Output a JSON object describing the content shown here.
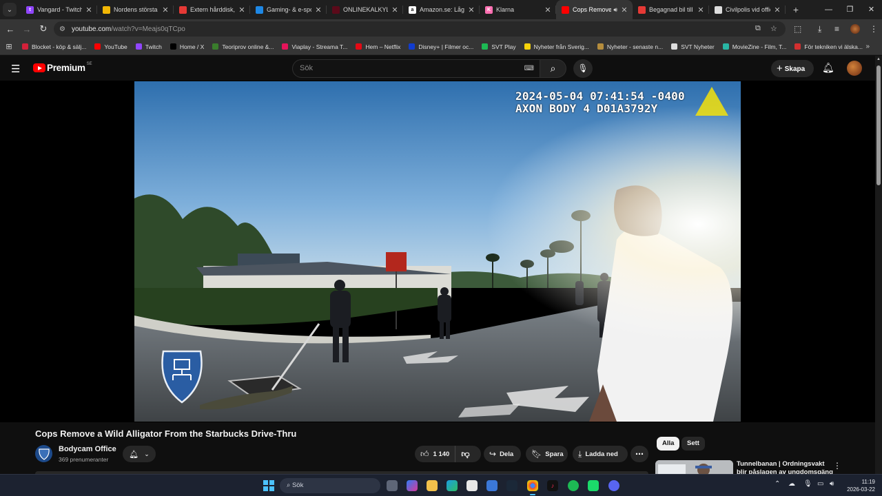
{
  "browser": {
    "tabs": [
      {
        "title": "Vangard - Twitch",
        "fav_color": "#9146ff",
        "fav_glyph": "t",
        "active": false
      },
      {
        "title": "Nordens största e",
        "fav_color": "#f2b705",
        "fav_glyph": "",
        "active": false
      },
      {
        "title": "Extern hårddisk, S",
        "fav_color": "#e53935",
        "fav_glyph": "",
        "active": false
      },
      {
        "title": "Gaming- & e-sport",
        "fav_color": "#1e88e5",
        "fav_glyph": "",
        "active": false
      },
      {
        "title": "ONLINEKALKYLAT",
        "fav_color": "#5b0a1a",
        "fav_glyph": "",
        "active": false
      },
      {
        "title": "Amazon.se: Låga p",
        "fav_color": "#ffffff",
        "fav_glyph": "a",
        "active": false
      },
      {
        "title": "Klarna",
        "fav_color": "#ff6fb1",
        "fav_glyph": "K",
        "active": false
      },
      {
        "title": "Cops Remove",
        "fav_color": "#ff0000",
        "fav_glyph": "",
        "active": true,
        "playing": true
      },
      {
        "title": "Begagnad bil till s",
        "fav_color": "#e53935",
        "fav_glyph": "",
        "active": false
      },
      {
        "title": "Civilpolis vid offic",
        "fav_color": "#dddddd",
        "fav_glyph": "",
        "active": false
      }
    ],
    "url_host": "youtube.com",
    "url_path": "/watch?v=Meajs0qTCpo",
    "bookmarks": [
      {
        "label": "Blocket - köp & sälj...",
        "color": "#d3213a"
      },
      {
        "label": "YouTube",
        "color": "#ff0000"
      },
      {
        "label": "Twitch",
        "color": "#9146ff"
      },
      {
        "label": "Home / X",
        "color": "#000000"
      },
      {
        "label": "Teoriprov online &...",
        "color": "#3a7d2c"
      },
      {
        "label": "Viaplay - Streama T...",
        "color": "#e5145a"
      },
      {
        "label": "Hem – Netflix",
        "color": "#e50914"
      },
      {
        "label": "Disney+ | Filmer oc...",
        "color": "#113ccf"
      },
      {
        "label": "SVT Play",
        "color": "#1db954"
      },
      {
        "label": "Nyheter från Sverig...",
        "color": "#f5d20a"
      },
      {
        "label": "Nyheter - senaste n...",
        "color": "#b58d3d"
      },
      {
        "label": "SVT Nyheter",
        "color": "#dddddd"
      },
      {
        "label": "MovieZine - Film, T...",
        "color": "#29b6a4"
      },
      {
        "label": "För tekniken vi älska...",
        "color": "#d32f2f"
      }
    ]
  },
  "youtube": {
    "logo_text": "Premium",
    "logo_country": "SE",
    "search_placeholder": "Sök",
    "create_label": "Skapa",
    "video": {
      "overlay_line1": "2024-05-04 07:41:54 -0400",
      "overlay_line2": "AXON BODY 4 D01A3792Y",
      "title": "Cops Remove a Wild Alligator From the Starbucks Drive-Thru",
      "channel": "Bodycam Office",
      "subscribers": "369 prenumeranter",
      "likes": "1 140",
      "share_label": "Dela",
      "save_label": "Spara",
      "download_label": "Ladda ned"
    },
    "chips": [
      "Alla",
      "Sett"
    ],
    "recommended": [
      {
        "title": "Tunnelbanan | Ordningsvakt blir påslagen av ungdomsgäng"
      }
    ]
  },
  "taskbar": {
    "search_placeholder": "Sök",
    "time": "11:19",
    "date": "2026-03-22"
  }
}
